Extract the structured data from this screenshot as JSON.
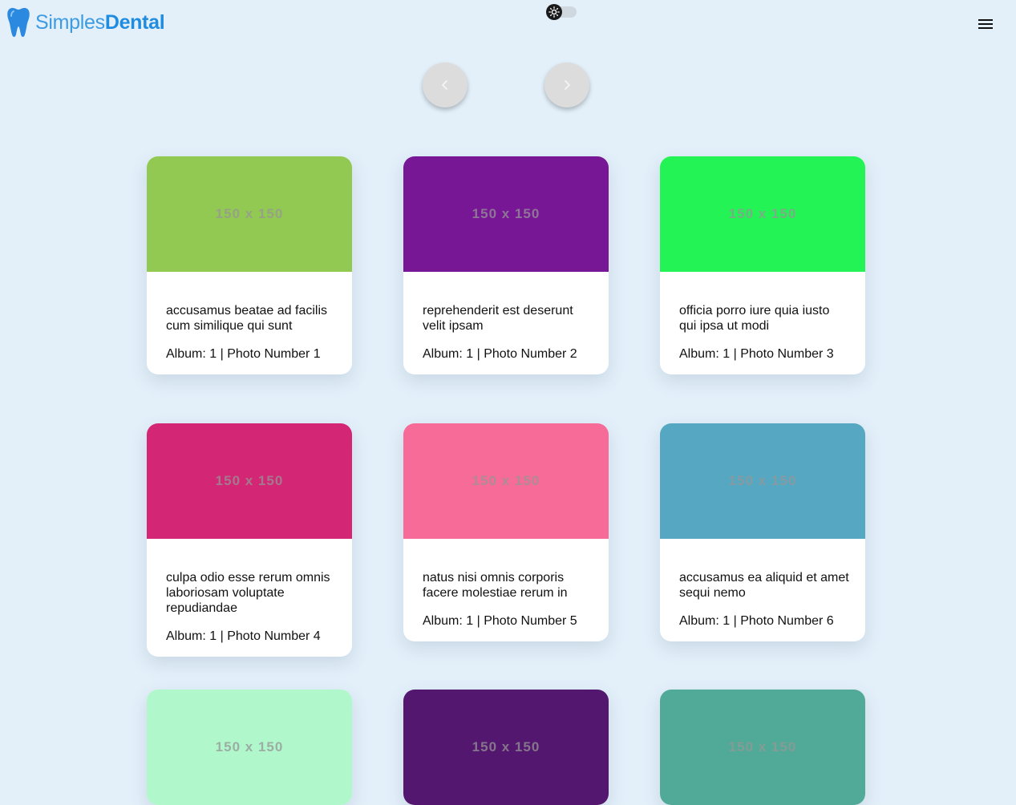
{
  "header": {
    "logo_text_light": "Simples",
    "logo_text_bold": "Dental",
    "logo_icon": "tooth-icon",
    "theme_toggle_icon": "sun-icon",
    "menu_icon": "hamburger-menu-icon"
  },
  "pagination": {
    "prev_icon": "chevron-left-icon",
    "next_icon": "chevron-right-icon"
  },
  "colors": {
    "background": "#e3f0fa",
    "brand": "#1f8ce0"
  },
  "photos": [
    {
      "placeholder": "150 x 150",
      "color": "#92c952",
      "title": "accusamus beatae ad facilis cum similique qui sunt",
      "meta": "Album: 1 | Photo Number 1"
    },
    {
      "placeholder": "150 x 150",
      "color": "#771796",
      "title": "reprehenderit est deserunt velit ipsam",
      "meta": "Album: 1 | Photo Number 2"
    },
    {
      "placeholder": "150 x 150",
      "color": "#24f355",
      "title": "officia porro iure quia iusto qui ipsa ut modi",
      "meta": "Album: 1 | Photo Number 3"
    },
    {
      "placeholder": "150 x 150",
      "color": "#d32776",
      "title": "culpa odio esse rerum omnis laboriosam voluptate repudiandae",
      "meta": "Album: 1 | Photo Number 4"
    },
    {
      "placeholder": "150 x 150",
      "color": "#f66b97",
      "title": "natus nisi omnis corporis facere molestiae rerum in",
      "meta": "Album: 1 | Photo Number 5"
    },
    {
      "placeholder": "150 x 150",
      "color": "#56a8c2",
      "title": "accusamus ea aliquid et amet sequi nemo",
      "meta": "Album: 1 | Photo Number 6"
    },
    {
      "placeholder": "150 x 150",
      "color": "#b0f7cc"
    },
    {
      "placeholder": "150 x 150",
      "color": "#54176f"
    },
    {
      "placeholder": "150 x 150",
      "color": "#51aa97"
    }
  ]
}
